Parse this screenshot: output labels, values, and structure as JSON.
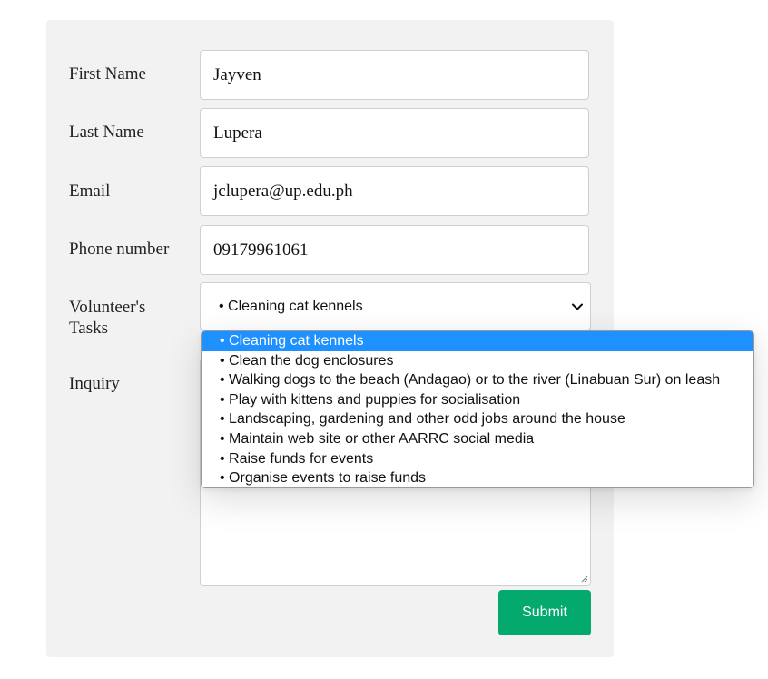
{
  "form": {
    "first_name_label": "First Name",
    "first_name_value": "Jayven",
    "last_name_label": "Last Name",
    "last_name_value": "Lupera",
    "email_label": "Email",
    "email_value": "jclupera@up.edu.ph",
    "phone_label": "Phone number",
    "phone_value": "09179961061",
    "tasks_label_line1": "Volunteer's",
    "tasks_label_line2": "Tasks",
    "tasks_selected": "• Cleaning cat kennels",
    "inquiry_label": "Inquiry",
    "submit_label": "Submit"
  },
  "dropdown": {
    "options": [
      "• Cleaning cat kennels",
      "• Clean the dog enclosures",
      "• Walking dogs to the beach (Andagao) or to the river (Linabuan Sur) on leash",
      "• Play with kittens and puppies for socialisation",
      "• Landscaping, gardening and other odd jobs around the house",
      "• Maintain web site or other AARRC social media",
      "• Raise funds for events",
      "• Organise events to raise funds"
    ]
  },
  "colors": {
    "panel_bg": "#f2f2f2",
    "submit_bg": "#04aa6d",
    "highlight": "#1e90ff"
  }
}
